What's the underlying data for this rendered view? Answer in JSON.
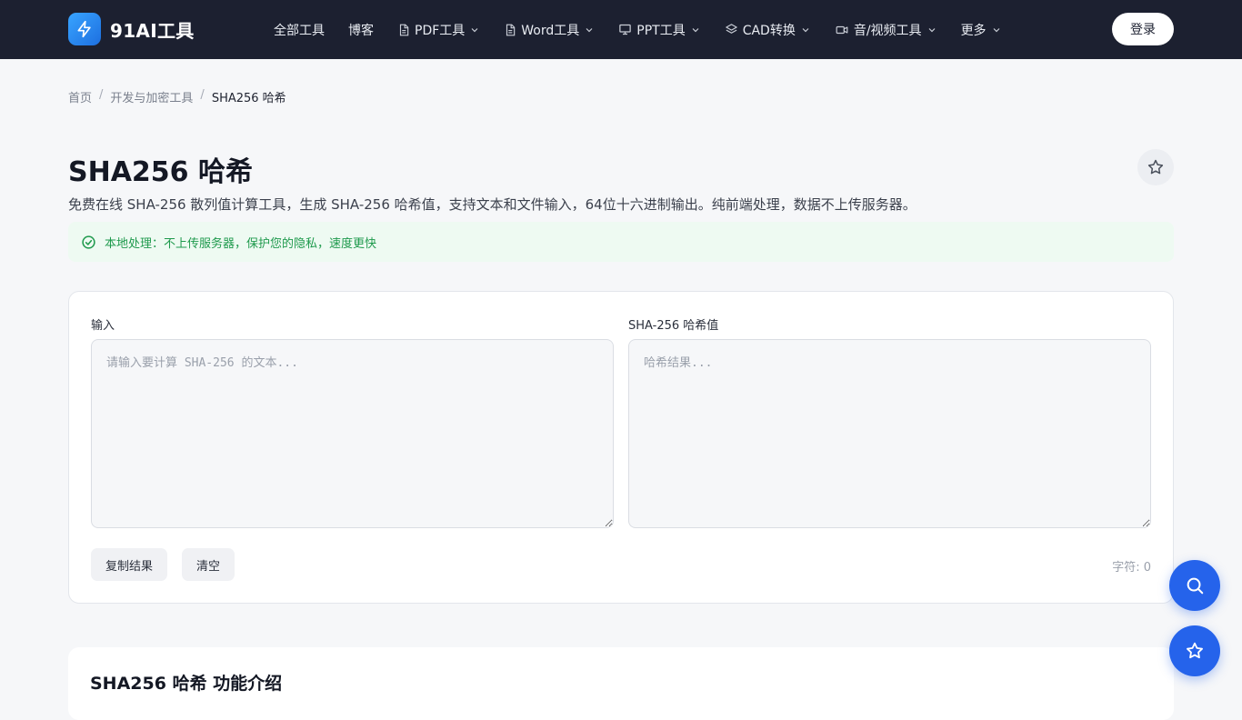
{
  "brand": {
    "name": "91AI工具"
  },
  "nav": {
    "items": [
      {
        "label": "全部工具",
        "icon": ""
      },
      {
        "label": "博客",
        "icon": ""
      },
      {
        "label": "PDF工具",
        "icon": "file-icon"
      },
      {
        "label": "Word工具",
        "icon": "file-icon"
      },
      {
        "label": "PPT工具",
        "icon": "presentation-icon"
      },
      {
        "label": "CAD转换",
        "icon": "layers-icon"
      },
      {
        "label": "音/视频工具",
        "icon": "video-icon"
      },
      {
        "label": "更多",
        "icon": ""
      }
    ],
    "login_label": "登录"
  },
  "breadcrumb": {
    "home": "首页",
    "category": "开发与加密工具",
    "current": "SHA256 哈希",
    "separator": "/"
  },
  "page": {
    "title": "SHA256 哈希",
    "description": "免费在线 SHA-256 散列值计算工具，生成 SHA-256 哈希值，支持文本和文件输入，64位十六进制输出。纯前端处理，数据不上传服务器。",
    "notice": "本地处理：不上传服务器，保护您的隐私，速度更快"
  },
  "tool": {
    "input_label": "输入",
    "input_placeholder": "请输入要计算 SHA-256 的文本...",
    "output_label": "SHA-256 哈希值",
    "output_placeholder": "哈希结果...",
    "copy_label": "复制结果",
    "clear_label": "清空",
    "char_count": "字符: 0"
  },
  "intro": {
    "title": "SHA256 哈希 功能介绍"
  },
  "colors": {
    "navbar_bg": "#1c2030",
    "accent": "#2563eb",
    "notice_bg": "#eefaf2",
    "notice_text": "#1f9a4d"
  }
}
